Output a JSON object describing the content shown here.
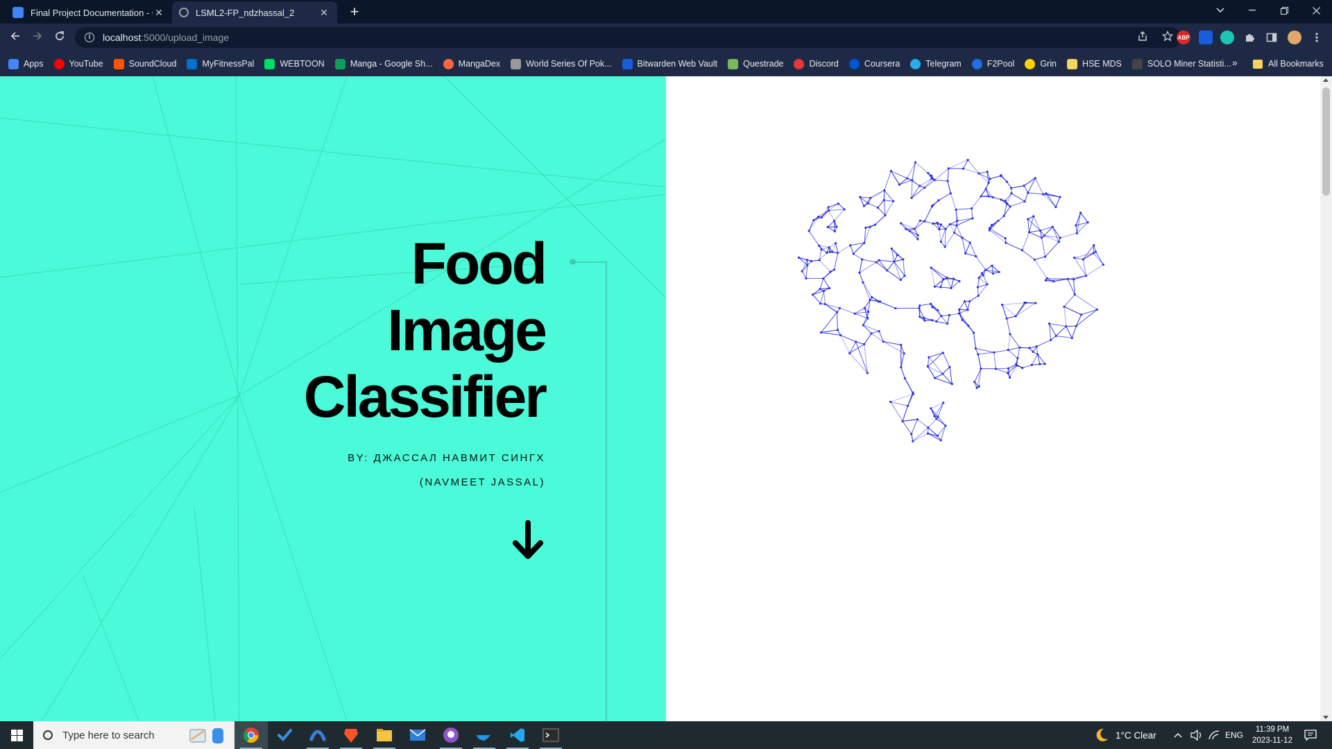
{
  "browser": {
    "tabs": [
      {
        "title": "Final Project Documentation - G",
        "icon": "google-docs-icon",
        "active": false
      },
      {
        "title": "LSML2-FP_ndzhassal_2",
        "icon": "globe-icon",
        "active": true
      }
    ],
    "close_glyph": "✕",
    "new_tab_glyph": "+",
    "address": {
      "host": "localhost",
      "path": ":5000/upload_image"
    },
    "bookmarks": [
      {
        "label": "Apps",
        "color": "#4285f4"
      },
      {
        "label": "YouTube",
        "color": "#ff0000"
      },
      {
        "label": "SoundCloud",
        "color": "#ff5500"
      },
      {
        "label": "MyFitnessPal",
        "color": "#0072ce"
      },
      {
        "label": "WEBTOON",
        "color": "#00dc64"
      },
      {
        "label": "Manga - Google Sh...",
        "color": "#0f9d58"
      },
      {
        "label": "MangaDex",
        "color": "#ff6740"
      },
      {
        "label": "World Series Of Pok...",
        "color": "#999999"
      },
      {
        "label": "Bitwarden Web Vault",
        "color": "#175ddc"
      },
      {
        "label": "Questrade",
        "color": "#7bb661"
      },
      {
        "label": "Discord",
        "color": "#e53935"
      },
      {
        "label": "Coursera",
        "color": "#0056d2"
      },
      {
        "label": "Telegram",
        "color": "#2aabee"
      },
      {
        "label": "F2Pool",
        "color": "#1f6fe5"
      },
      {
        "label": "Grin",
        "color": "#ffd400"
      },
      {
        "label": "HSE MDS",
        "color": "#f4d35e"
      },
      {
        "label": "SOLO Miner Statisti...",
        "color": "#444444"
      }
    ],
    "bookmarks_more": "»",
    "all_bookmarks": "All Bookmarks"
  },
  "page": {
    "title_lines": [
      "Food",
      "Image",
      "Classifier"
    ],
    "byline_1": "BY: ДЖАССАЛ НАВМИТ СИНГХ",
    "byline_2": "(NAVMEET JASSAL)",
    "accent_color": "#4bfad8",
    "brain_color": "#2a2fe0"
  },
  "taskbar": {
    "search_placeholder": "Type here to search",
    "weather": "1°C  Clear",
    "language": "ENG",
    "time": "11:39 PM",
    "date": "2023-11-12"
  }
}
